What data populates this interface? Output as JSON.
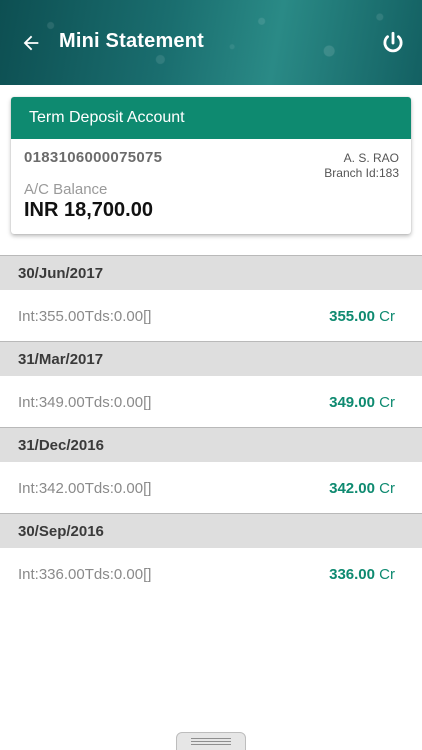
{
  "header": {
    "title": "Mini Statement",
    "back_icon": "arrow-left-icon",
    "power_icon": "power-icon"
  },
  "account": {
    "type": "Term Deposit Account",
    "number": "0183106000075075",
    "holder": "A. S. RAO",
    "branch": "Branch Id:183",
    "balance_label": "A/C Balance",
    "balance": "INR 18,700.00"
  },
  "transactions": [
    {
      "date": "30/Jun/2017",
      "description": "Int:355.00Tds:0.00[]",
      "amount": "355.00",
      "type": "Cr"
    },
    {
      "date": "31/Mar/2017",
      "description": "Int:349.00Tds:0.00[]",
      "amount": "349.00",
      "type": "Cr"
    },
    {
      "date": "31/Dec/2016",
      "description": "Int:342.00Tds:0.00[]",
      "amount": "342.00",
      "type": "Cr"
    },
    {
      "date": "30/Sep/2016",
      "description": "Int:336.00Tds:0.00[]",
      "amount": "336.00",
      "type": "Cr"
    }
  ],
  "colors": {
    "accent": "#0e8a70",
    "header_dark": "#0d4f52",
    "date_band": "#dedede"
  }
}
